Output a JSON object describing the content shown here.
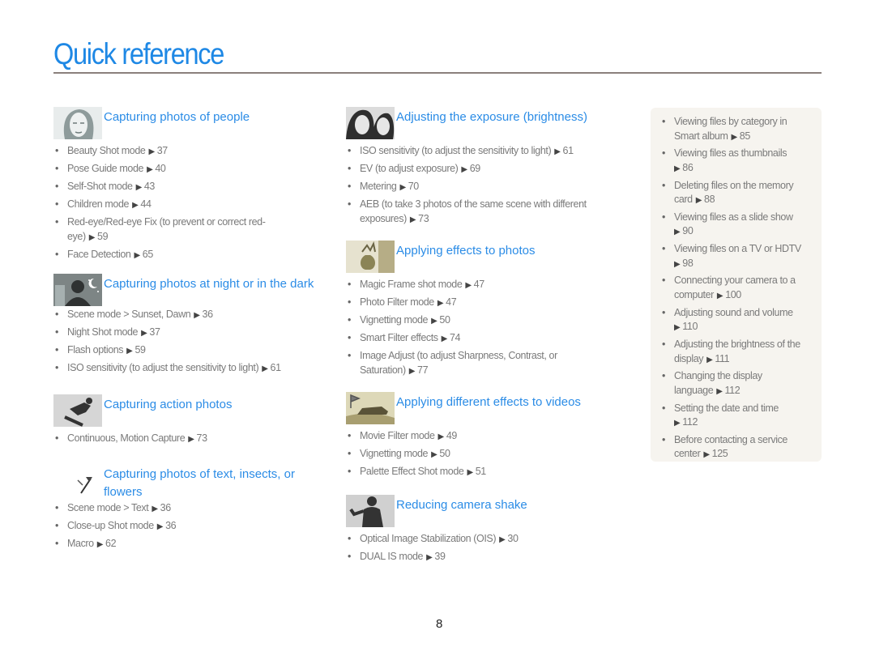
{
  "page": {
    "title": "Quick reference",
    "page_number": "8",
    "accent_color": "#2b8ce6",
    "arrow_glyph": "▶"
  },
  "sections": {
    "people": {
      "icon": "woman-portrait-icon",
      "title": "Capturing photos of people",
      "items": [
        {
          "text": "Beauty Shot mode",
          "page": "37"
        },
        {
          "text": "Pose Guide mode",
          "page": "40"
        },
        {
          "text": "Self-Shot mode",
          "page": "43"
        },
        {
          "text": "Children mode",
          "page": "44"
        },
        {
          "text": "Red-eye/Red-eye Fix (to prevent or correct red-eye)",
          "page": "59"
        },
        {
          "text": "Face Detection",
          "page": "65"
        }
      ]
    },
    "night": {
      "icon": "night-silhouette-icon",
      "title": "Capturing photos at night or in the dark",
      "items": [
        {
          "text": "Scene mode > Sunset, Dawn",
          "page": "36"
        },
        {
          "text": "Night Shot mode",
          "page": "37"
        },
        {
          "text": "Flash options",
          "page": "59"
        },
        {
          "text": "ISO sensitivity (to adjust the sensitivity to light)",
          "page": "61"
        }
      ]
    },
    "action": {
      "icon": "snowboarder-icon",
      "title": "Capturing action photos",
      "items": [
        {
          "text": "Continuous, Motion Capture",
          "page": "73"
        }
      ]
    },
    "closeup": {
      "icon": "flower-icon",
      "title": "Capturing  photos of text, insects, or flowers",
      "items": [
        {
          "text": "Scene mode > Text",
          "page": "36"
        },
        {
          "text": "Close-up Shot mode",
          "page": "36"
        },
        {
          "text": "Macro",
          "page": "62"
        }
      ]
    },
    "exposure": {
      "icon": "couple-portrait-icon",
      "title": "Adjusting the exposure (brightness)",
      "items": [
        {
          "text": "ISO sensitivity (to adjust the sensitivity to light)",
          "page": "61"
        },
        {
          "text": "EV (to adjust exposure)",
          "page": "69"
        },
        {
          "text": "Metering",
          "page": "70"
        },
        {
          "text": "AEB (to take 3 photos of the same scene with different exposures)",
          "page": "73"
        }
      ]
    },
    "effects": {
      "icon": "vase-icon",
      "title": "Applying effects to photos",
      "items": [
        {
          "text": "Magic Frame shot mode",
          "page": "47"
        },
        {
          "text": "Photo Filter mode",
          "page": "47"
        },
        {
          "text": "Vignetting mode",
          "page": "50"
        },
        {
          "text": "Smart Filter effects",
          "page": "74"
        },
        {
          "text": "Image Adjust (to adjust Sharpness, Contrast, or Saturation)",
          "page": "77"
        }
      ]
    },
    "video": {
      "icon": "race-car-icon",
      "title": "Applying different effects to videos",
      "items": [
        {
          "text": "Movie Filter mode",
          "page": "49"
        },
        {
          "text": "Vignetting mode",
          "page": "50"
        },
        {
          "text": "Palette Effect Shot mode",
          "page": "51"
        }
      ]
    },
    "shake": {
      "icon": "waving-person-icon",
      "title": "Reducing camera shake",
      "items": [
        {
          "text": "Optical Image Stabilization (OIS)",
          "page": "30"
        },
        {
          "text": "DUAL IS mode",
          "page": "39"
        }
      ]
    }
  },
  "sidebar": {
    "items": [
      {
        "text": "Viewing files by category in Smart album",
        "page": "85"
      },
      {
        "text": "Viewing files as thumbnails",
        "page": "86"
      },
      {
        "text": "Deleting files on the memory card",
        "page": "88"
      },
      {
        "text": "Viewing files as a slide show",
        "page": "90"
      },
      {
        "text": "Viewing files on a TV or HDTV",
        "page": "98"
      },
      {
        "text": "Connecting your camera to a computer",
        "page": "100"
      },
      {
        "text": "Adjusting sound and volume",
        "page": "110"
      },
      {
        "text": "Adjusting the brightness of the display",
        "page": "111"
      },
      {
        "text": "Changing the display language",
        "page": "112"
      },
      {
        "text": "Setting the date and time",
        "page": "112"
      },
      {
        "text": "Before contacting a service center",
        "page": "125"
      }
    ]
  }
}
